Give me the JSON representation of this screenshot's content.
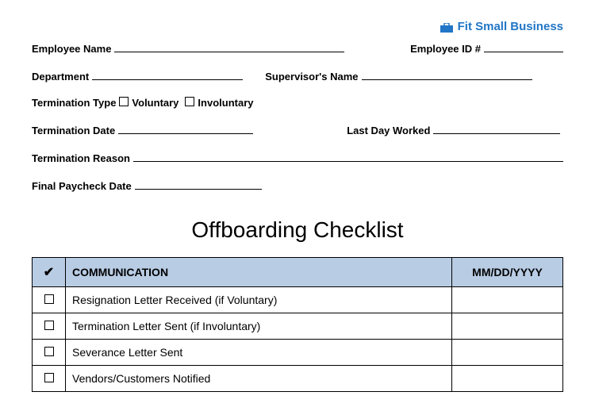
{
  "brand": "Fit Small Business",
  "fields": {
    "employee_name": "Employee Name",
    "employee_id": "Employee ID #",
    "department": "Department",
    "supervisor": "Supervisor's Name",
    "termination_type": "Termination Type",
    "voluntary": "Voluntary",
    "involuntary": "Involuntary",
    "termination_date": "Termination Date",
    "last_day": "Last Day Worked",
    "termination_reason": "Termination Reason",
    "final_paycheck": "Final Paycheck Date"
  },
  "title": "Offboarding Checklist",
  "table": {
    "headers": {
      "check": "✔",
      "section": "COMMUNICATION",
      "date": "MM/DD/YYYY"
    },
    "rows": [
      "Resignation Letter Received (if Voluntary)",
      "Termination Letter Sent (if Involuntary)",
      "Severance Letter Sent",
      "Vendors/Customers Notified"
    ]
  }
}
